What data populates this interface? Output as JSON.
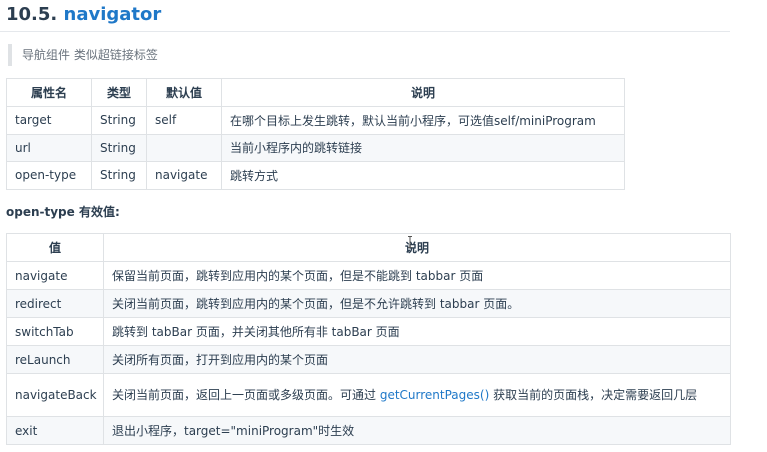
{
  "heading": {
    "number": "10.5.",
    "title": "navigator"
  },
  "description": "导航组件 类似超链接标签",
  "props_table": {
    "headers": [
      "属性名",
      "类型",
      "默认值",
      "说明"
    ],
    "rows": [
      {
        "name": "target",
        "type": "String",
        "default": "self",
        "desc": "在哪个目标上发生跳转，默认当前小程序，可选值self/miniProgram"
      },
      {
        "name": "url",
        "type": "String",
        "default": "",
        "desc": "当前小程序内的跳转链接"
      },
      {
        "name": "open-type",
        "type": "String",
        "default": "navigate",
        "desc": "跳转方式"
      }
    ]
  },
  "subheading": {
    "code": "open-type",
    "text": " 有效值:"
  },
  "values_table": {
    "headers": [
      "值",
      "说明"
    ],
    "rows": [
      {
        "value": "navigate",
        "desc": "保留当前页面，跳转到应用内的某个页面，但是不能跳到 tabbar 页面"
      },
      {
        "value": "redirect",
        "desc": "关闭当前页面，跳转到应用内的某个页面，但是不允许跳转到 tabbar 页面。"
      },
      {
        "value": "switchTab",
        "desc": "跳转到 tabBar 页面，并关闭其他所有非 tabBar 页面"
      },
      {
        "value": "reLaunch",
        "desc": "关闭所有页面，打开到应用内的某个页面"
      },
      {
        "value": "navigateBack",
        "desc_before": "关闭当前页面，返回上一页面或多级页面。可通过 ",
        "desc_link": "getCurrentPages()",
        "desc_after": " 获取当前的页面栈，决定需要返回几层"
      },
      {
        "value": "exit",
        "desc": "退出小程序，target=\"miniProgram\"时生效"
      }
    ]
  },
  "colors": {
    "accent": "#1f78c8",
    "text": "#2c3e50",
    "border": "#dfe2e5",
    "stripe": "#f6f8fa"
  }
}
